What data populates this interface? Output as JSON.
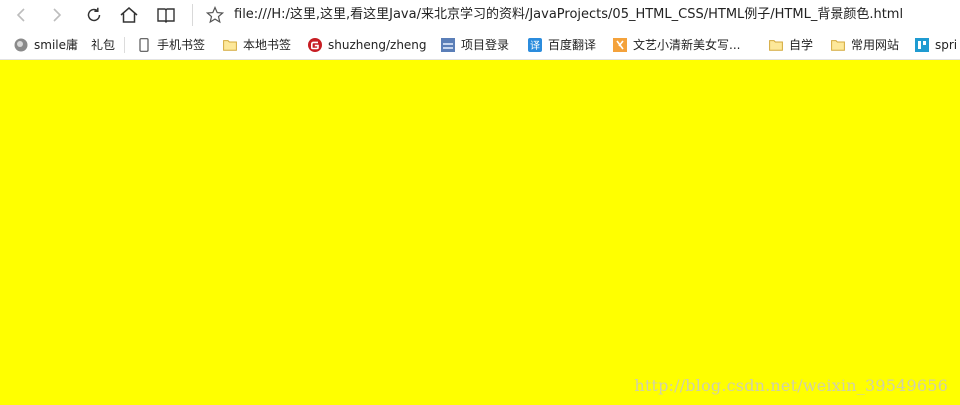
{
  "browser": {
    "address_bar": {
      "url": "file:///H:/这里,这里,看这里Java/来北京学习的资料/JavaProjects/05_HTML_CSS/HTML例子/HTML_背景颜色.html"
    },
    "nav": {
      "back_icon": "chevron-left-icon",
      "forward_icon": "chevron-right-icon",
      "refresh_icon": "refresh-icon",
      "home_icon": "home-icon",
      "reading_icon": "book-icon",
      "favorite_icon": "star-icon"
    },
    "bookmarks": [
      {
        "label": "smile庸",
        "icon": "avatar-icon"
      },
      {
        "label": "礼包",
        "icon": ""
      },
      {
        "label": "手机书签",
        "icon": "phone-icon"
      },
      {
        "label": "本地书签",
        "icon": "folder-icon"
      },
      {
        "label": "shuzheng/zheng",
        "icon": "gitee-icon"
      },
      {
        "label": "项目登录",
        "icon": "site-icon"
      },
      {
        "label": "百度翻译",
        "icon": "translate-icon"
      },
      {
        "label": "文艺小清新美女写...",
        "icon": "site-icon"
      },
      {
        "label": "自学",
        "icon": "folder-icon"
      },
      {
        "label": "常用网站",
        "icon": "folder-icon"
      },
      {
        "label": "spri",
        "icon": "site-icon"
      }
    ]
  },
  "page": {
    "background_color": "#ffff00",
    "watermark": "http://blog.csdn.net/weixin_39549656"
  }
}
